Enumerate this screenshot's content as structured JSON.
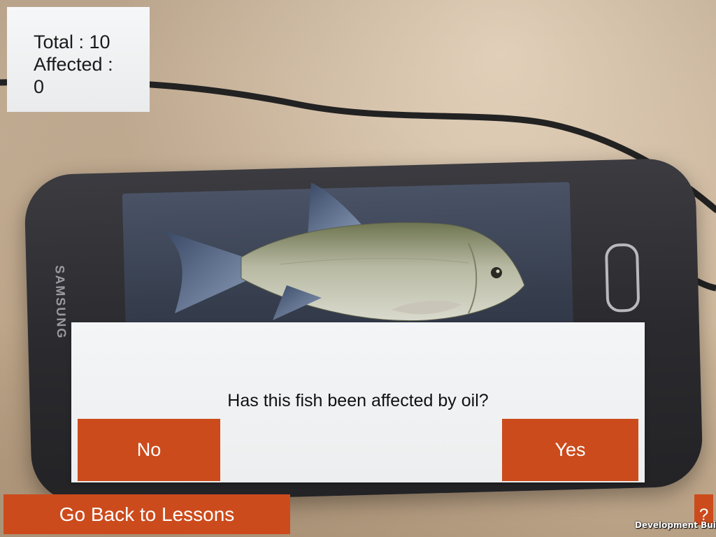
{
  "counter": {
    "total_label": "Total : 10",
    "affected_label": "Affected :",
    "affected_value": "0"
  },
  "dialog": {
    "question": "Has this fish been affected by oil?",
    "no_label": "No",
    "yes_label": "Yes"
  },
  "footer": {
    "back_label": "Go Back to Lessons",
    "help_label": "?",
    "dev_build_label": "Development Build"
  },
  "background": {
    "phone_brand": "SAMSUNG"
  },
  "colors": {
    "accent": "#cc4b1c",
    "panel": "#eceeef"
  },
  "icons": {
    "help": "question-mark-icon",
    "fish": "fish-3d-model"
  }
}
